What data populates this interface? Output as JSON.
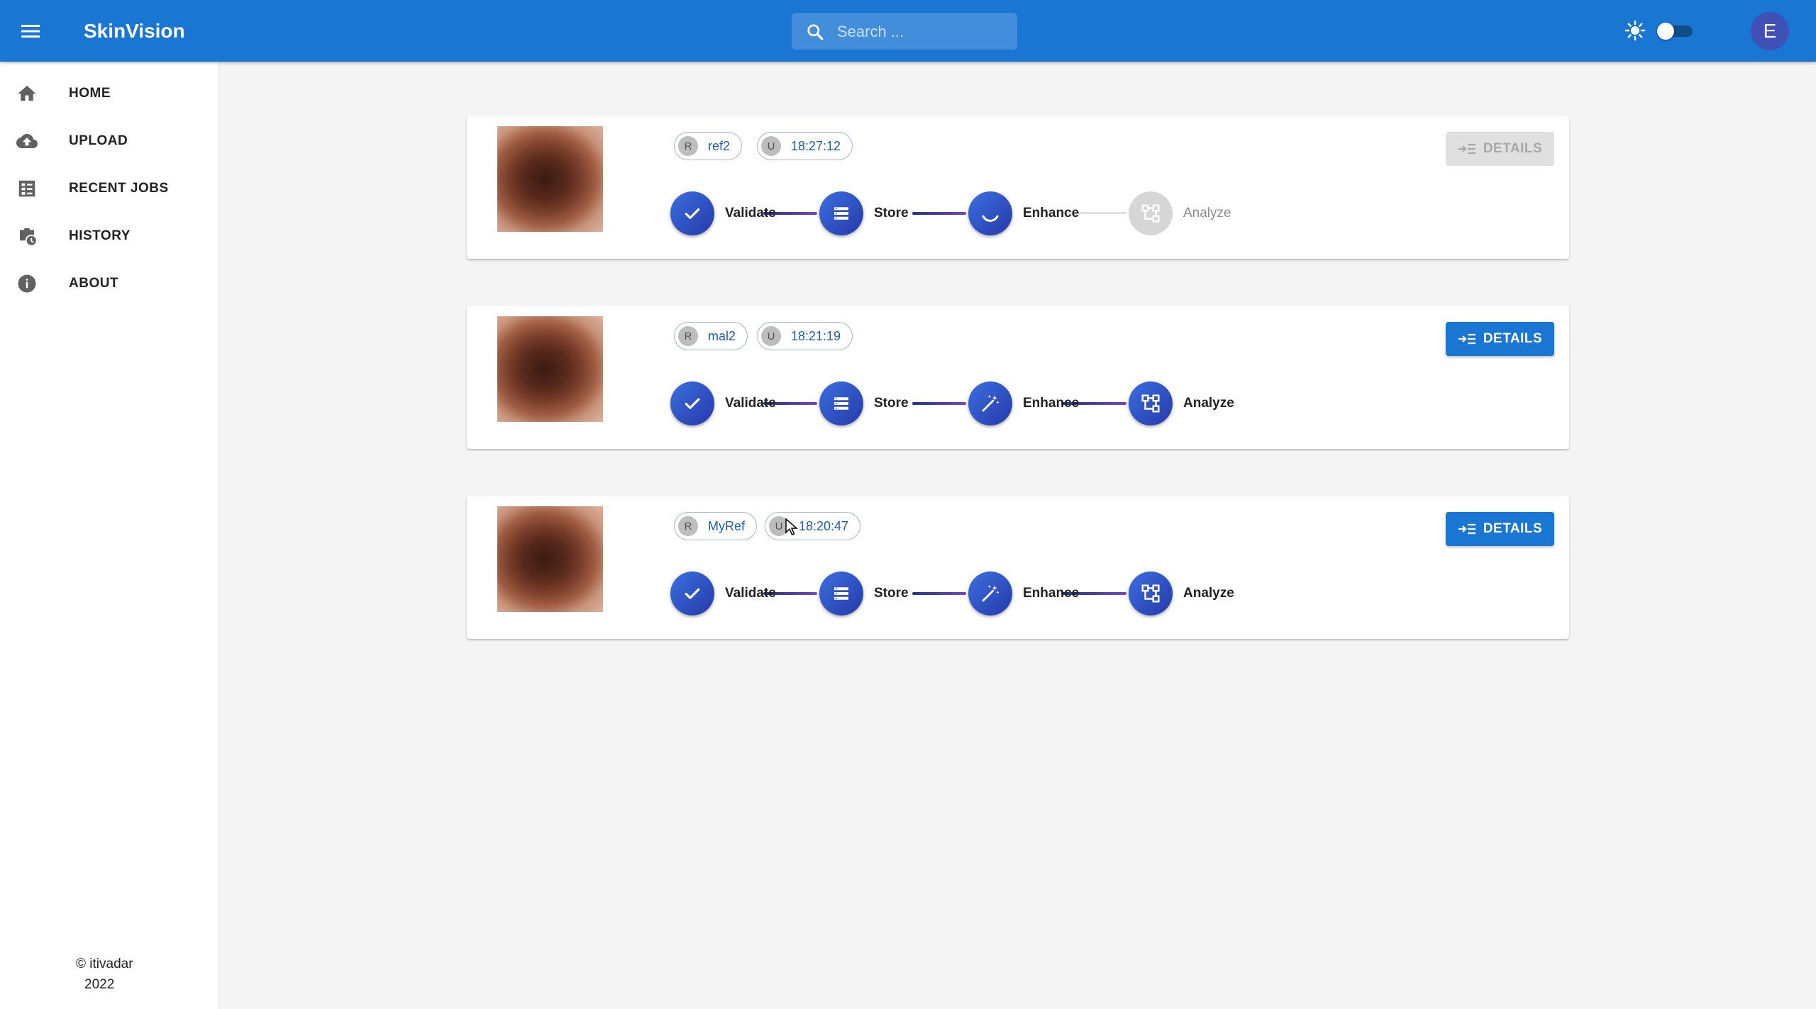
{
  "app": {
    "title": "SkinVision"
  },
  "search": {
    "placeholder": "Search ..."
  },
  "user": {
    "initial": "E"
  },
  "sidebar": {
    "items": [
      {
        "label": "HOME",
        "icon": "home-icon"
      },
      {
        "label": "UPLOAD",
        "icon": "cloud-upload-icon"
      },
      {
        "label": "RECENT JOBS",
        "icon": "recent-jobs-icon"
      },
      {
        "label": "HISTORY",
        "icon": "history-icon"
      },
      {
        "label": "ABOUT",
        "icon": "info-icon"
      }
    ],
    "copyright_line1": "© itivadar",
    "copyright_line2": "2022"
  },
  "steps": [
    "Validate",
    "Store",
    "Enhance",
    "Analyze"
  ],
  "details_label": "DETAILS",
  "jobs": [
    {
      "ref_avatar": "R",
      "ref": "ref2",
      "user_avatar": "U",
      "time": "18:27:12",
      "status": "running",
      "details_enabled": false,
      "step_states": [
        "done",
        "done",
        "running",
        "pending"
      ]
    },
    {
      "ref_avatar": "R",
      "ref": "mal2",
      "user_avatar": "U",
      "time": "18:21:19",
      "status": "complete",
      "details_enabled": true,
      "step_states": [
        "done",
        "done",
        "done",
        "done"
      ]
    },
    {
      "ref_avatar": "R",
      "ref": "MyRef",
      "user_avatar": "U",
      "time": "18:20:47",
      "status": "complete",
      "details_enabled": true,
      "step_states": [
        "done",
        "done",
        "done",
        "done"
      ]
    }
  ],
  "colors": {
    "appbar": "#1976d2",
    "accent": "#3f51b5",
    "background": "#f4f4f4"
  }
}
